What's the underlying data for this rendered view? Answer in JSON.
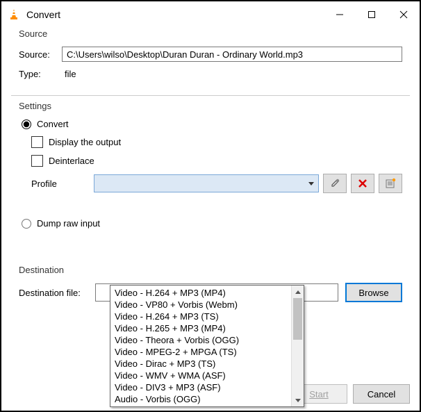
{
  "window": {
    "title": "Convert"
  },
  "source": {
    "legend": "Source",
    "label": "Source:",
    "value": "C:\\Users\\wilso\\Desktop\\Duran Duran - Ordinary World.mp3",
    "type_label": "Type:",
    "type_value": "file"
  },
  "settings": {
    "legend": "Settings",
    "convert_label": "Convert",
    "display_output_label": "Display the output",
    "deinterlace_label": "Deinterlace",
    "profile_label": "Profile",
    "dump_label": "Dump raw input",
    "profile_options": [
      "Video - H.264 + MP3 (MP4)",
      "Video - VP80 + Vorbis (Webm)",
      "Video - H.264 + MP3 (TS)",
      "Video - H.265 + MP3 (MP4)",
      "Video - Theora + Vorbis (OGG)",
      "Video - MPEG-2 + MPGA (TS)",
      "Video - Dirac + MP3 (TS)",
      "Video - WMV + WMA (ASF)",
      "Video - DIV3 + MP3 (ASF)",
      "Audio - Vorbis (OGG)"
    ]
  },
  "destination": {
    "legend": "Destination",
    "label": "Destination file:",
    "browse": "Browse"
  },
  "footer": {
    "start": "Start",
    "cancel": "Cancel"
  }
}
